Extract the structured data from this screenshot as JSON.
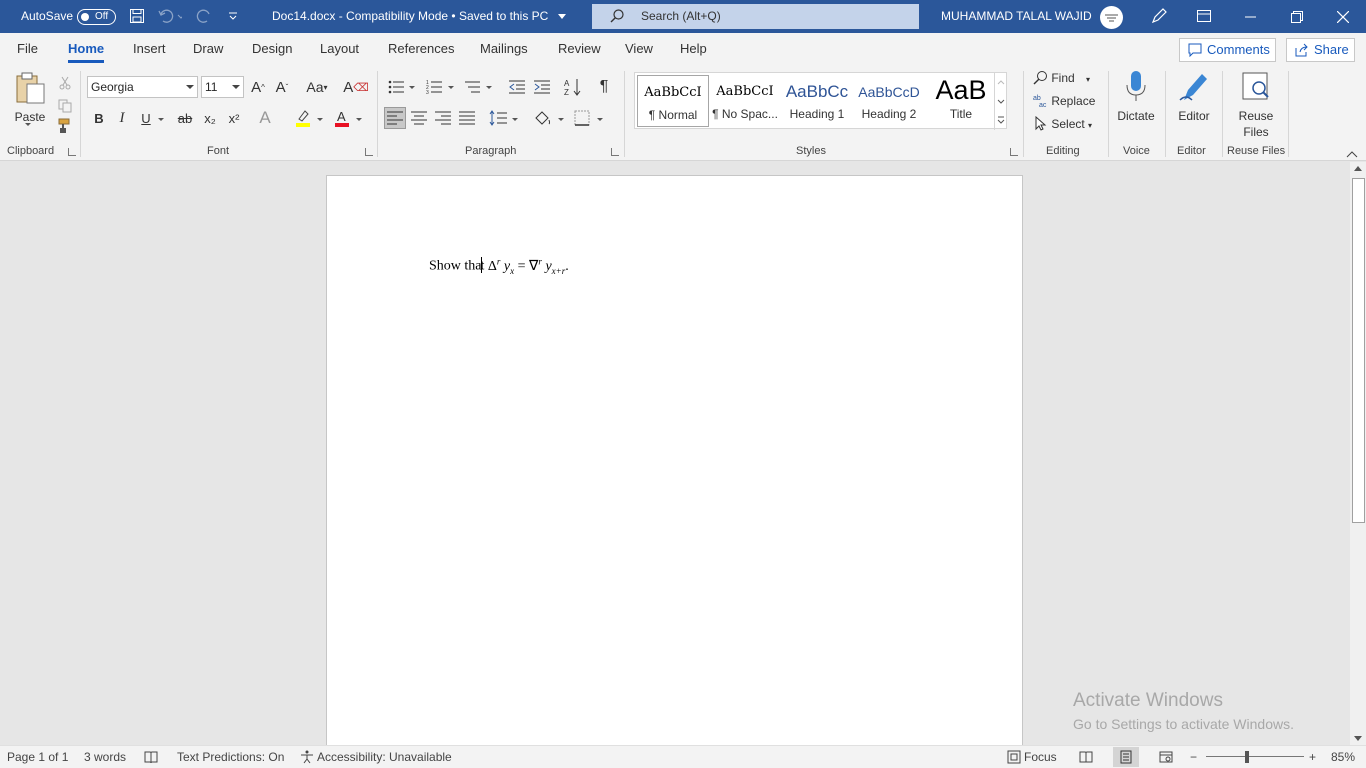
{
  "titlebar": {
    "autosave_label": "AutoSave",
    "autosave_state": "Off",
    "doc_title": "Doc14.docx  -  Compatibility Mode • Saved to this PC",
    "search_placeholder": "Search (Alt+Q)",
    "user_name": "MUHAMMAD TALAL WAJID"
  },
  "menu": {
    "tabs": [
      "File",
      "Home",
      "Insert",
      "Draw",
      "Design",
      "Layout",
      "References",
      "Mailings",
      "Review",
      "View",
      "Help"
    ],
    "active_tab": "Home",
    "comments_label": "Comments",
    "share_label": "Share"
  },
  "ribbon": {
    "clipboard": {
      "paste_label": "Paste",
      "group_label": "Clipboard"
    },
    "font": {
      "font_name": "Georgia",
      "font_size": "11",
      "group_label": "Font",
      "increase": "A^",
      "decrease": "Aˇ",
      "change_case": "Aa",
      "bold": "B",
      "italic": "I",
      "underline": "U",
      "strike": "ab",
      "subscript": "x₂",
      "superscript": "x²"
    },
    "paragraph": {
      "group_label": "Paragraph",
      "pilcrow": "¶"
    },
    "styles": {
      "group_label": "Styles",
      "items": [
        {
          "sample": "AaBbCcI",
          "name": "¶ Normal"
        },
        {
          "sample": "AaBbCcI",
          "name": "¶ No Spac..."
        },
        {
          "sample": "AaBbCc",
          "name": "Heading 1"
        },
        {
          "sample": "AaBbCcD",
          "name": "Heading 2"
        },
        {
          "sample": "AaB",
          "name": "Title"
        }
      ]
    },
    "editing": {
      "group_label": "Editing",
      "find": "Find",
      "replace": "Replace",
      "select": "Select"
    },
    "voice": {
      "group_label": "Voice",
      "dictate": "Dictate"
    },
    "editor": {
      "group_label": "Editor",
      "editor": "Editor"
    },
    "reuse": {
      "group_label": "Reuse Files",
      "line1": "Reuse",
      "line2": "Files"
    }
  },
  "document": {
    "text_before_caret": "Show tha",
    "text_after_caret": "t ",
    "math": {
      "delta": "Δ",
      "sup_r": "r",
      "y": "y",
      "sub_x": "x",
      "equals": " = ",
      "nabla": "∇",
      "sub_xr": "x+r",
      "period": "."
    }
  },
  "watermark": {
    "line1": "Activate Windows",
    "line2": "Go to Settings to activate Windows."
  },
  "status": {
    "page": "Page 1 of 1",
    "words": "3 words",
    "text_predictions": "Text Predictions: On",
    "accessibility": "Accessibility: Unavailable",
    "focus": "Focus",
    "zoom": "85%",
    "zoom_level_percent": 85
  },
  "colors": {
    "brand": "#2b579a",
    "accent": "#185abd",
    "highlight": "#ffff00",
    "font_color": "#e81123"
  }
}
